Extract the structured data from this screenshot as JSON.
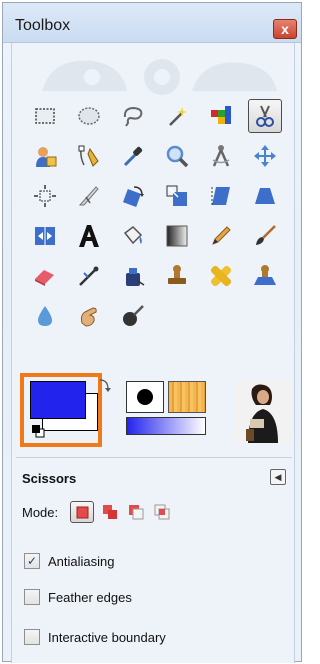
{
  "window": {
    "title": "Toolbox",
    "close_glyph": "x"
  },
  "tools": [
    {
      "name": "rect-select-tool",
      "icon": "rect-select-icon"
    },
    {
      "name": "ellipse-select-tool",
      "icon": "ellipse-select-icon"
    },
    {
      "name": "free-select-tool",
      "icon": "lasso-icon"
    },
    {
      "name": "fuzzy-select-tool",
      "icon": "magic-wand-icon"
    },
    {
      "name": "select-by-color-tool",
      "icon": "color-select-icon"
    },
    {
      "name": "scissors-tool",
      "icon": "scissors-icon",
      "selected": true
    },
    {
      "name": "foreground-select-tool",
      "icon": "foreground-select-icon"
    },
    {
      "name": "paths-tool",
      "icon": "pen-path-icon"
    },
    {
      "name": "color-picker-tool",
      "icon": "eyedropper-icon"
    },
    {
      "name": "zoom-tool",
      "icon": "magnifier-icon"
    },
    {
      "name": "measure-tool",
      "icon": "compass-icon"
    },
    {
      "name": "move-tool",
      "icon": "move-arrows-icon"
    },
    {
      "name": "align-tool",
      "icon": "align-icon"
    },
    {
      "name": "crop-tool",
      "icon": "crop-knife-icon"
    },
    {
      "name": "rotate-tool",
      "icon": "rotate-icon"
    },
    {
      "name": "scale-tool",
      "icon": "scale-icon"
    },
    {
      "name": "shear-tool",
      "icon": "shear-icon"
    },
    {
      "name": "perspective-tool",
      "icon": "perspective-icon"
    },
    {
      "name": "flip-tool",
      "icon": "flip-icon"
    },
    {
      "name": "text-tool",
      "icon": "text-a-icon"
    },
    {
      "name": "bucket-fill-tool",
      "icon": "bucket-icon"
    },
    {
      "name": "blend-tool",
      "icon": "gradient-icon"
    },
    {
      "name": "pencil-tool",
      "icon": "pencil-icon"
    },
    {
      "name": "paintbrush-tool",
      "icon": "paintbrush-icon"
    },
    {
      "name": "eraser-tool",
      "icon": "eraser-icon"
    },
    {
      "name": "airbrush-tool",
      "icon": "airbrush-icon"
    },
    {
      "name": "ink-tool",
      "icon": "ink-icon"
    },
    {
      "name": "clone-tool",
      "icon": "stamp-icon"
    },
    {
      "name": "heal-tool",
      "icon": "bandage-icon"
    },
    {
      "name": "perspective-clone-tool",
      "icon": "perspective-stamp-icon"
    },
    {
      "name": "blur-sharpen-tool",
      "icon": "water-drop-icon"
    },
    {
      "name": "smudge-tool",
      "icon": "smudge-hand-icon"
    },
    {
      "name": "dodge-burn-tool",
      "icon": "dodge-burn-icon"
    }
  ],
  "colors": {
    "foreground": "#2323ee",
    "background": "#ffffff",
    "highlight": "#f07a1a"
  },
  "tool_options": {
    "title": "Scissors",
    "mode_label": "Mode:",
    "modes": [
      {
        "name": "replace-mode",
        "active": true
      },
      {
        "name": "add-mode",
        "active": false
      },
      {
        "name": "subtract-mode",
        "active": false
      },
      {
        "name": "intersect-mode",
        "active": false
      }
    ],
    "antialiasing": {
      "label": "Antialiasing",
      "checked": true
    },
    "feather": {
      "label": "Feather edges",
      "checked": false
    },
    "interactive": {
      "label": "Interactive boundary",
      "checked": false
    }
  }
}
